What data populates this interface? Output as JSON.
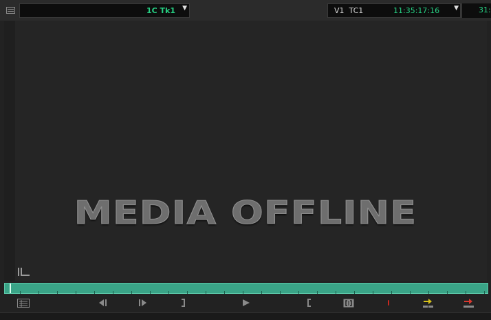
{
  "header": {
    "menu_icon": "hamburger-menu-icon",
    "clip_name": "1C Tk1",
    "track_label": "V1  TC1",
    "timecode": "11:35:17:16",
    "timecode_secondary": "31:"
  },
  "viewer": {
    "status_text": "MEDIA OFFLINE",
    "track_indicator_icon": "track-indicator-icon"
  },
  "timeline": {
    "position_fraction": 0.01,
    "color": "#3aa487"
  },
  "controls": [
    {
      "name": "clip-menu-button",
      "icon": "clip-menu-icon"
    },
    {
      "name": "step-back-button",
      "icon": "step-back-icon"
    },
    {
      "name": "step-forward-button",
      "icon": "step-forward-icon"
    },
    {
      "name": "mark-out-button",
      "icon": "mark-out-icon"
    },
    {
      "name": "play-button",
      "icon": "play-icon"
    },
    {
      "name": "mark-in-button",
      "icon": "mark-in-icon"
    },
    {
      "name": "mark-clip-button",
      "icon": "mark-clip-icon"
    },
    {
      "name": "add-marker-button",
      "icon": "marker-icon"
    },
    {
      "name": "splice-in-button",
      "icon": "splice-in-icon",
      "color": "#d8c21a"
    },
    {
      "name": "overwrite-button",
      "icon": "overwrite-icon",
      "color": "#d9382f"
    }
  ]
}
